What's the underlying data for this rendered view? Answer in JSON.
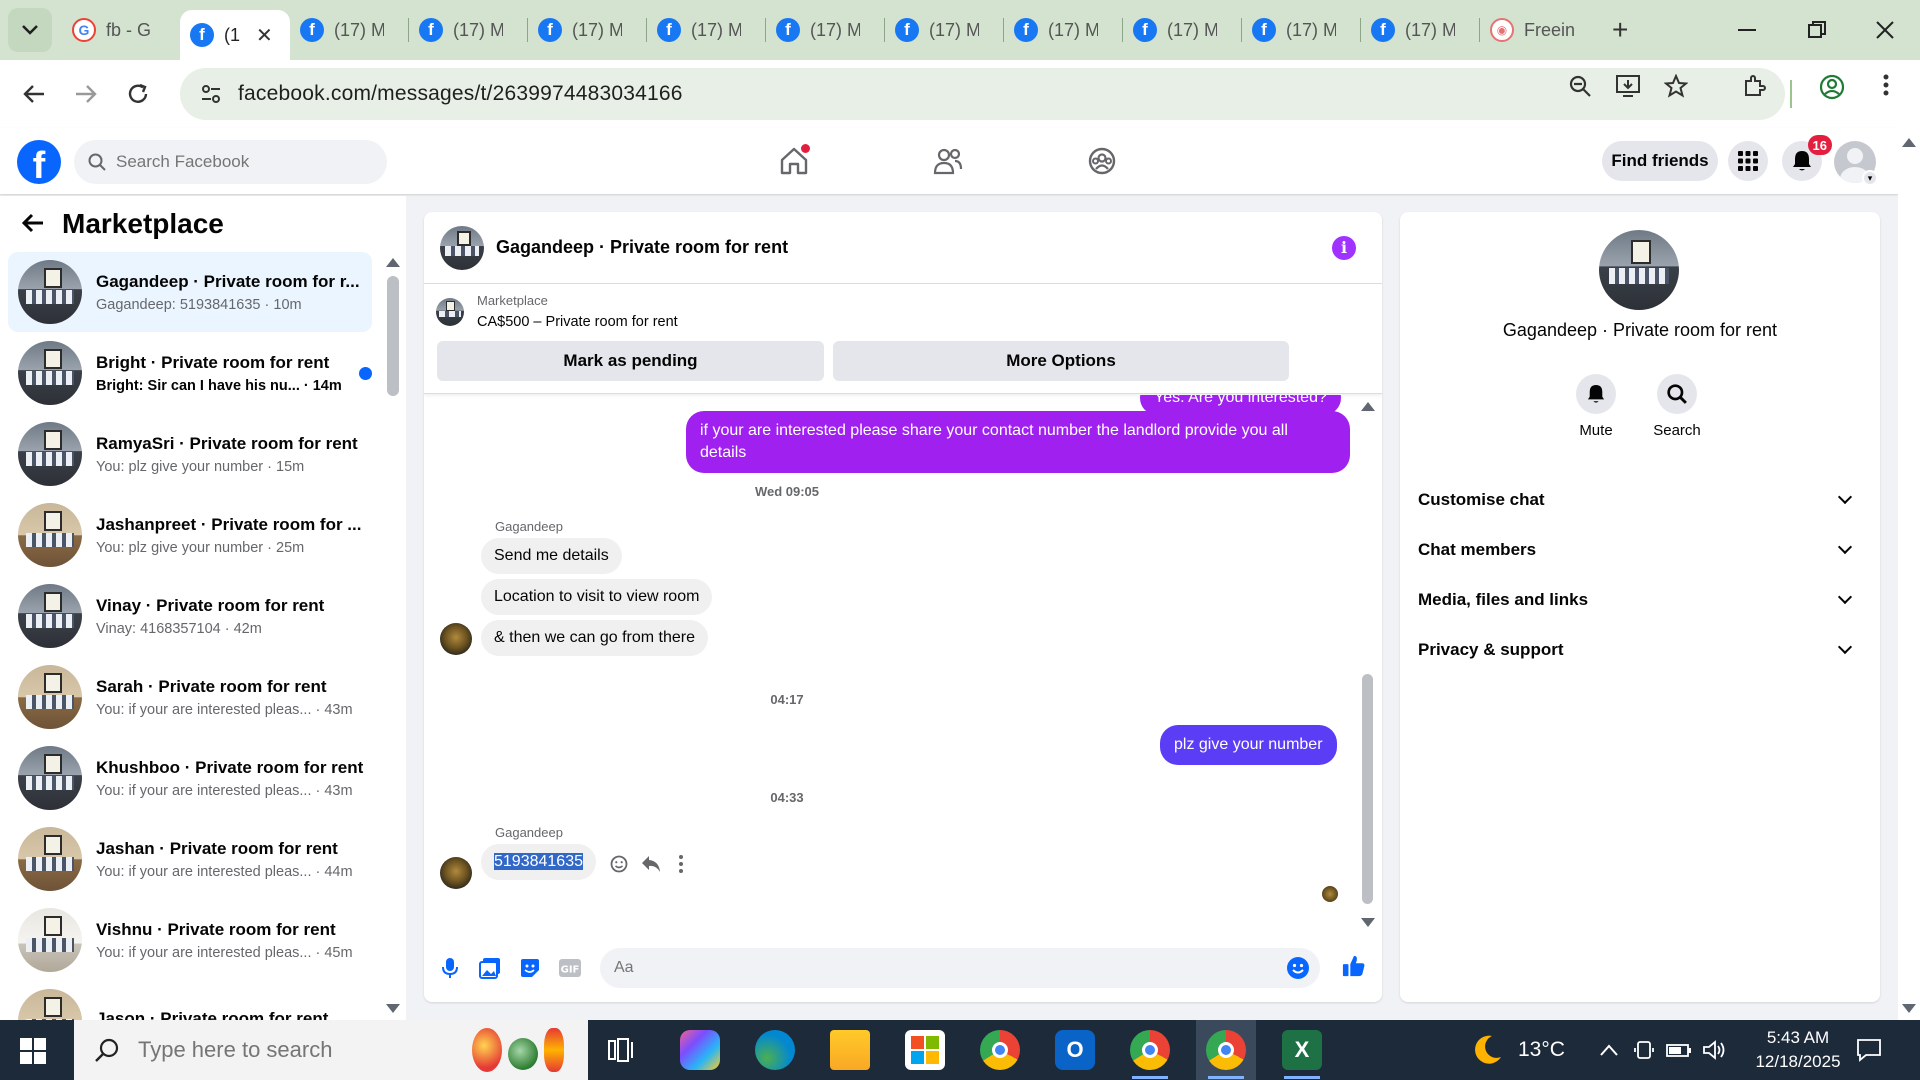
{
  "browser": {
    "tabs": [
      {
        "label": "fb - G",
        "icon": "google-icon",
        "active": false
      },
      {
        "label": "(1",
        "icon": "facebook-icon",
        "active": true
      },
      {
        "label": "(17) M",
        "icon": "facebook-icon",
        "active": false
      },
      {
        "label": "(17) M",
        "icon": "facebook-icon",
        "active": false
      },
      {
        "label": "(17) M",
        "icon": "facebook-icon",
        "active": false
      },
      {
        "label": "(17) M",
        "icon": "facebook-icon",
        "active": false
      },
      {
        "label": "(17) M",
        "icon": "facebook-icon",
        "active": false
      },
      {
        "label": "(17) M",
        "icon": "facebook-icon",
        "active": false
      },
      {
        "label": "(17) M",
        "icon": "facebook-icon",
        "active": false
      },
      {
        "label": "(17) M",
        "icon": "facebook-icon",
        "active": false
      },
      {
        "label": "(17) M",
        "icon": "facebook-icon",
        "active": false
      },
      {
        "label": "(17) M",
        "icon": "facebook-icon",
        "active": false
      },
      {
        "label": "Freein",
        "icon": "freeing-icon",
        "active": false
      }
    ],
    "url": "facebook.com/messages/t/2639974483034166"
  },
  "fb": {
    "search_placeholder": "Search Facebook",
    "find_friends": "Find friends",
    "notifications_count": "16",
    "brand_color": "#0866ff"
  },
  "sidebar": {
    "title": "Marketplace",
    "conversations": [
      {
        "name": "Gagandeep · Private room for r...",
        "snippet": "Gagandeep: 5193841635 · 10m",
        "active": true,
        "unread": false
      },
      {
        "name": "Bright · Private room for rent",
        "snippet": "Bright: Sir can I have his nu... · 14m",
        "active": false,
        "unread": true
      },
      {
        "name": "RamyaSri · Private room for rent",
        "snippet": "You: plz give your number · 15m",
        "active": false,
        "unread": false
      },
      {
        "name": "Jashanpreet · Private room for ...",
        "snippet": "You: plz give your number · 25m",
        "active": false,
        "unread": false
      },
      {
        "name": "Vinay · Private room for rent",
        "snippet": "Vinay: 4168357104 · 42m",
        "active": false,
        "unread": false
      },
      {
        "name": "Sarah · Private room for rent",
        "snippet": "You: if your are interested pleas... · 43m",
        "active": false,
        "unread": false
      },
      {
        "name": "Khushboo · Private room for rent",
        "snippet": "You: if your are interested pleas... · 43m",
        "active": false,
        "unread": false
      },
      {
        "name": "Jashan · Private room for rent",
        "snippet": "You: if your are interested pleas... · 44m",
        "active": false,
        "unread": false
      },
      {
        "name": "Vishnu · Private room for rent",
        "snippet": "You: if your are interested pleas... · 45m",
        "active": false,
        "unread": false
      },
      {
        "name": "Jason · Private room for rent",
        "snippet": "",
        "active": false,
        "unread": false
      }
    ]
  },
  "chat": {
    "title": "Gagandeep · Private room for rent",
    "marketplace_label": "Marketplace",
    "listing": "CA$500 – Private room for rent",
    "mark_pending": "Mark as pending",
    "more_options": "More Options",
    "partial_top_message": "Yes. Are you interested?",
    "out_message_1": "if your are interested please share your contact number the landlord provide you all details",
    "ts_1": "Wed 09:05",
    "sender_1": "Gagandeep",
    "in_1": "Send me details",
    "in_2": "Location to visit to view room",
    "in_3": "& then we can go from there",
    "ts_2": "04:17",
    "out_message_2": "plz give your number",
    "ts_3": "04:33",
    "sender_2": "Gagandeep",
    "in_4": "5193841635",
    "composer_placeholder": "Aa",
    "outgoing_color": "#a020f0",
    "outgoing_color_2": "#5b3df5"
  },
  "info_panel": {
    "name": "Gagandeep · Private room for rent",
    "mute": "Mute",
    "search": "Search",
    "sections": [
      "Customise chat",
      "Chat members",
      "Media, files and links",
      "Privacy & support"
    ]
  },
  "taskbar": {
    "search_placeholder": "Type here to search",
    "temperature": "13°C",
    "time": "5:43 AM",
    "date": "12/18/2025"
  }
}
